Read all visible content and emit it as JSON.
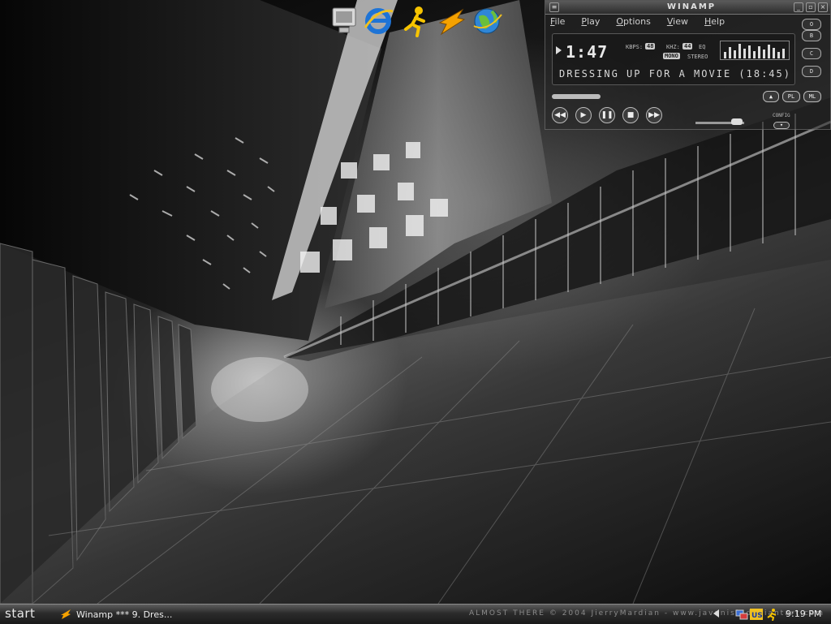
{
  "desktop": {
    "icons": [
      {
        "name": "my-computer-icon"
      },
      {
        "name": "internet-explorer-icon"
      },
      {
        "name": "aim-running-man-icon"
      },
      {
        "name": "winamp-lightning-icon"
      },
      {
        "name": "globe-network-icon"
      }
    ]
  },
  "winamp": {
    "title": "WINAMP",
    "menu": [
      "File",
      "Play",
      "Options",
      "View",
      "Help"
    ],
    "time": "1:47",
    "kbps_label": "KBPS:",
    "kbps_value": "48",
    "khz_label": "KHZ:",
    "khz_value": "44",
    "mono_label": "MONO",
    "stereo_label": "STEREO",
    "eq_label": "EQ",
    "song_text": "DRESSING UP FOR A MOVIE (18:45)",
    "side_buttons": [
      "B",
      "C",
      "D",
      "O"
    ],
    "bottom_buttons": [
      "PL",
      "ML"
    ],
    "config_label": "CONFIG",
    "eject_label": "▲",
    "controls": [
      "◀◀",
      "▶",
      "❚❚",
      "■",
      "▶▶"
    ]
  },
  "taskbar": {
    "start_label": "start",
    "task_label": "Winamp *** 9. Dres...",
    "credit_text": "ALMOST THERE © 2004 JierryMardian - www.javanish.deviantart.com",
    "clock": "9:19 PM"
  },
  "tray": {
    "icons": [
      "network-icon",
      "us-language-icon",
      "aim-icon"
    ]
  },
  "colors": {
    "taskbar_top": "#5d5d5d",
    "taskbar_bottom": "#1a1a1a",
    "winamp_text": "#cfcfcf"
  }
}
